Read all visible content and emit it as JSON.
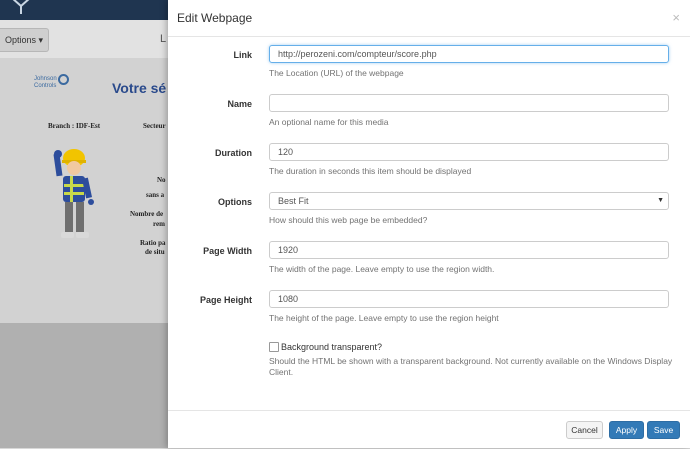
{
  "background": {
    "options_button": "Options",
    "toolbar_fragment": "L",
    "logo_text_line1": "Johnson",
    "logo_text_line2": "Controls",
    "page_title": "Votre sé",
    "branch_label": "Branch :  IDF-Est",
    "secteur_label": "Secteur",
    "frag1": "No",
    "frag2": "sans a",
    "frag3": "Nombre de",
    "frag4": "rem",
    "frag5": "Ratio pa",
    "frag6": "de situ"
  },
  "modal": {
    "title": "Edit Webpage",
    "close": "×",
    "fields": {
      "link": {
        "label": "Link",
        "value": "http://perozeni.com/compteur/score.php",
        "help": "The Location (URL) of the webpage"
      },
      "name": {
        "label": "Name",
        "value": "",
        "help": "An optional name for this media"
      },
      "duration": {
        "label": "Duration",
        "value": "120",
        "help": "The duration in seconds this item should be displayed"
      },
      "options": {
        "label": "Options",
        "value": "Best Fit",
        "help": "How should this web page be embedded?"
      },
      "page_width": {
        "label": "Page Width",
        "value": "1920",
        "help": "The width of the page. Leave empty to use the region width."
      },
      "page_height": {
        "label": "Page Height",
        "value": "1080",
        "help": "The height of the page. Leave empty to use the region height"
      }
    },
    "transparent": {
      "label": "Background transparent?",
      "help": "Should the HTML be shown with a transparent background. Not currently available on the Windows Display Client."
    },
    "buttons": {
      "cancel": "Cancel",
      "apply": "Apply",
      "save": "Save"
    }
  },
  "colors": {
    "primary": "#337ab7",
    "topbar": "#1f3550",
    "title_blue": "#2a4a8c"
  }
}
